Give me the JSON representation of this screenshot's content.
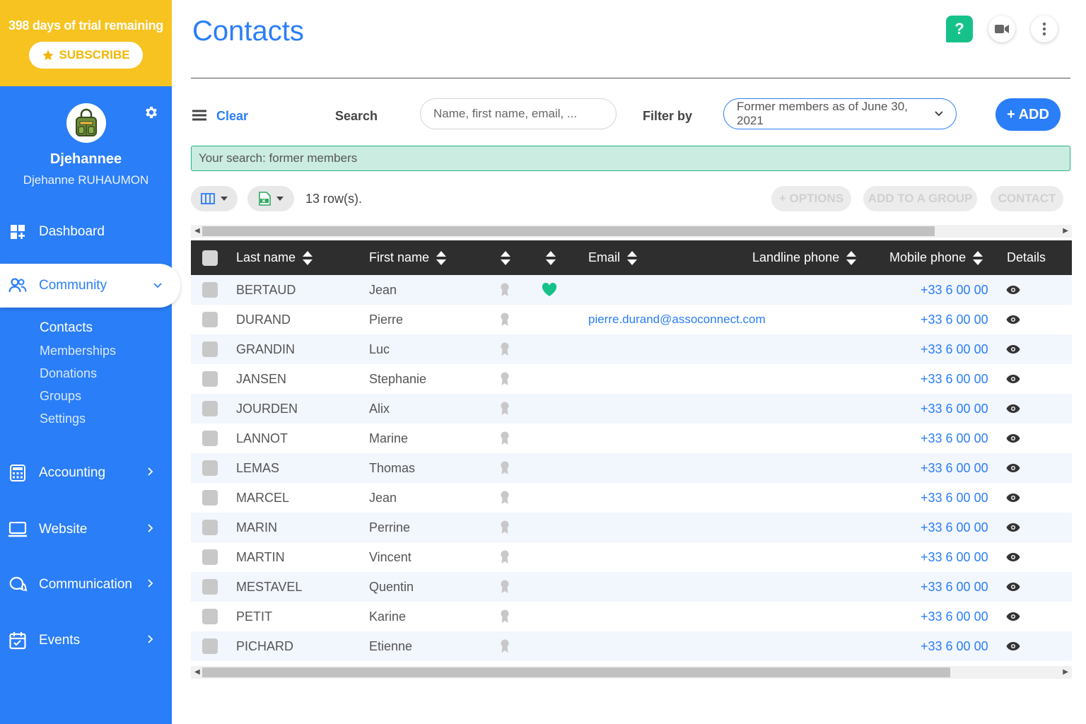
{
  "sidebar": {
    "trial_text": "398 days of trial remaining",
    "subscribe_label": "SUBSCRIBE",
    "profile_name": "Djehannee",
    "profile_fullname": "Djehanne RUHAUMON",
    "nav": {
      "dashboard": "Dashboard",
      "community": "Community",
      "accounting": "Accounting",
      "website": "Website",
      "communication": "Communication",
      "events": "Events"
    },
    "subnav": [
      "Contacts",
      "Memberships",
      "Donations",
      "Groups",
      "Settings"
    ]
  },
  "header": {
    "title": "Contacts",
    "help_label": "?"
  },
  "toolbar": {
    "clear_label": "Clear",
    "search_label": "Search",
    "search_placeholder": "Name, first name, email, ...",
    "filter_label": "Filter by",
    "filter_value": "Former members as of June 30, 2021",
    "add_label": "+ ADD"
  },
  "search_summary": "Your search: former members",
  "row_count": "13 row(s).",
  "actions": {
    "options": "+ OPTIONS",
    "add_to_group": "ADD TO A GROUP",
    "contact": "CONTACT"
  },
  "table": {
    "headers": {
      "last_name": "Last name",
      "first_name": "First name",
      "email": "Email",
      "landline": "Landline phone",
      "mobile": "Mobile phone",
      "details": "Details"
    },
    "rows": [
      {
        "last": "BERTAUD",
        "first": "Jean",
        "email": "",
        "mobile": "+33 6 00 00",
        "favorite": true
      },
      {
        "last": "DURAND",
        "first": "Pierre",
        "email": "pierre.durand@assoconnect.com",
        "mobile": "+33 6 00 00",
        "favorite": false
      },
      {
        "last": "GRANDIN",
        "first": "Luc",
        "email": "",
        "mobile": "+33 6 00 00",
        "favorite": false
      },
      {
        "last": "JANSEN",
        "first": "Stephanie",
        "email": "",
        "mobile": "+33 6 00 00",
        "favorite": false
      },
      {
        "last": "JOURDEN",
        "first": "Alix",
        "email": "",
        "mobile": "+33 6 00 00",
        "favorite": false
      },
      {
        "last": "LANNOT",
        "first": "Marine",
        "email": "",
        "mobile": "+33 6 00 00",
        "favorite": false
      },
      {
        "last": "LEMAS",
        "first": "Thomas",
        "email": "",
        "mobile": "+33 6 00 00",
        "favorite": false
      },
      {
        "last": "MARCEL",
        "first": "Jean",
        "email": "",
        "mobile": "+33 6 00 00",
        "favorite": false
      },
      {
        "last": "MARIN",
        "first": "Perrine",
        "email": "",
        "mobile": "+33 6 00 00",
        "favorite": false
      },
      {
        "last": "MARTIN",
        "first": "Vincent",
        "email": "",
        "mobile": "+33 6 00 00",
        "favorite": false
      },
      {
        "last": "MESTAVEL",
        "first": "Quentin",
        "email": "",
        "mobile": "+33 6 00 00",
        "favorite": false
      },
      {
        "last": "PETIT",
        "first": "Karine",
        "email": "",
        "mobile": "+33 6 00 00",
        "favorite": false
      },
      {
        "last": "PICHARD",
        "first": "Etienne",
        "email": "",
        "mobile": "+33 6 00 00",
        "favorite": false
      }
    ]
  },
  "colors": {
    "primary": "#2a7ef7",
    "trial_bg": "#f7c320",
    "help_green": "#16c28a",
    "favorite": "#16c28a",
    "summary_bg": "#cbece0"
  },
  "icons": [
    "gear-icon",
    "star-icon",
    "dashboard-icon",
    "community-icon",
    "calculator-icon",
    "monitor-icon",
    "chat-icon",
    "calendar-icon",
    "video-icon",
    "more-icon",
    "menu-icon",
    "columns-icon",
    "excel-icon",
    "eye-icon",
    "heart-icon",
    "badge-icon"
  ]
}
